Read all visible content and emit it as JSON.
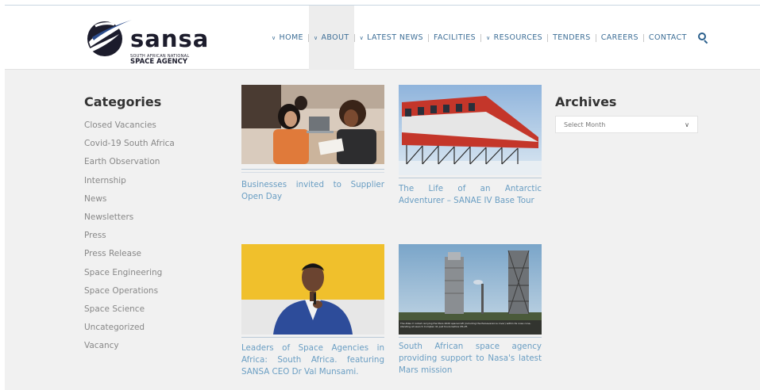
{
  "brand": {
    "name": "sansa",
    "line1": "SOUTH AFRICAN NATIONAL",
    "line2": "SPACE AGENCY",
    "colors": {
      "navy": "#1c1c2c",
      "swoosh": "#2b4c8c"
    }
  },
  "nav": {
    "items": [
      {
        "label": "HOME",
        "dropdown": true
      },
      {
        "label": "ABOUT",
        "dropdown": true
      },
      {
        "label": "LATEST NEWS",
        "dropdown": true
      },
      {
        "label": "FACILITIES",
        "dropdown": false
      },
      {
        "label": "RESOURCES",
        "dropdown": true
      },
      {
        "label": "TENDERS",
        "dropdown": false
      },
      {
        "label": "CAREERS",
        "dropdown": false
      },
      {
        "label": "CONTACT",
        "dropdown": false
      }
    ],
    "search_icon": "search-icon",
    "accent": "#3e6f97"
  },
  "categories": {
    "title": "Categories",
    "items": [
      "Closed Vacancies",
      "Covid-19 South Africa",
      "Earth Observation",
      "Internship",
      "News",
      "Newsletters",
      "Press",
      "Press Release",
      "Space Engineering",
      "Space Operations",
      "Space Science",
      "Uncategorized",
      "Vacancy"
    ]
  },
  "posts": [
    {
      "title": "Businesses invited to Supplier Open Day"
    },
    {
      "title": "The Life of an Antarctic Adventurer – SANAE IV Base Tour"
    },
    {
      "title": "Leaders of Space Agencies in Africa: South Africa. featuring SANSA CEO Dr Val Munsami."
    },
    {
      "title": "South African space agency providing support to Nasa's latest Mars mission",
      "caption": "The Atlas V rocket carrying the Mars 2020 spacecraft (including the Perseverance rover) within its nose cone, standing at Launch Complex 41 just hours before lift-off."
    }
  ],
  "archives": {
    "title": "Archives",
    "select_placeholder": "Select Month"
  }
}
